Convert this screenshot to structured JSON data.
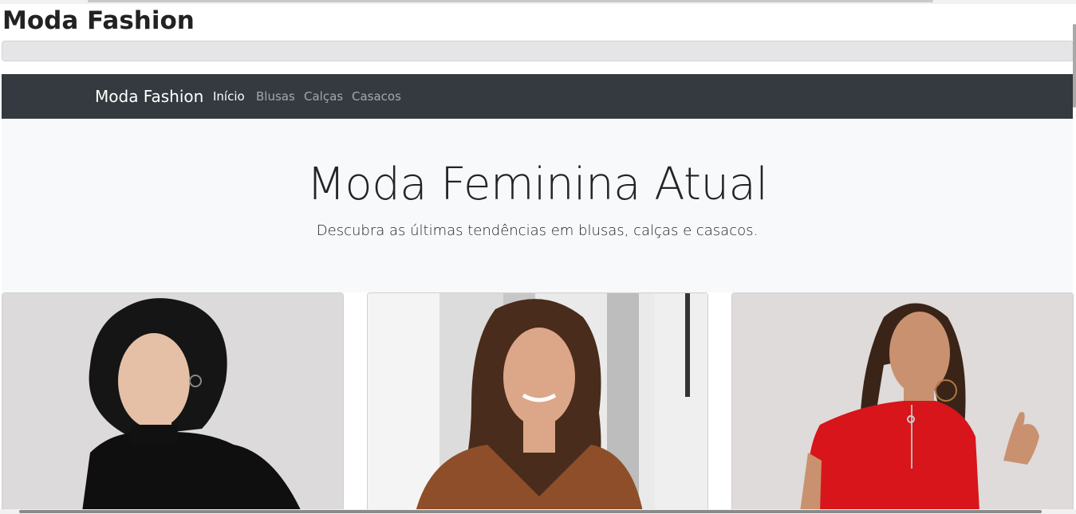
{
  "page": {
    "title": "Moda Fashion"
  },
  "navbar": {
    "brand": "Moda Fashion",
    "links": [
      {
        "label": "Início",
        "active": true
      },
      {
        "label": "Blusas",
        "active": false
      },
      {
        "label": "Calças",
        "active": false
      },
      {
        "label": "Casacos",
        "active": false
      }
    ]
  },
  "hero": {
    "title": "Moda Feminina Atual",
    "subtitle": "Descubra as últimas tendências em blusas, calças e casacos."
  },
  "products": [
    {
      "image": "woman-black-sweater"
    },
    {
      "image": "woman-brown-blouse"
    },
    {
      "image": "woman-red-top"
    }
  ],
  "colors": {
    "navbar": "#343a40",
    "hero_bg": "#f8f9fa",
    "text": "#212529"
  }
}
